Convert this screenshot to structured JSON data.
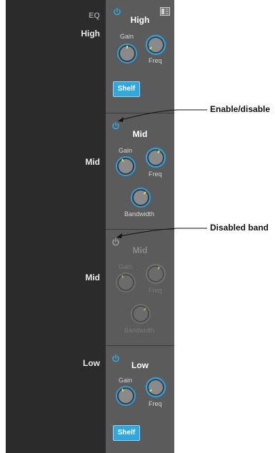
{
  "left_labels": {
    "eq": "EQ",
    "high": "High",
    "mid1": "Mid",
    "mid2": "Mid",
    "low": "Low"
  },
  "bands": [
    {
      "id": "high",
      "title": "High",
      "enabled": true,
      "knobs": {
        "gain": "Gain",
        "freq": "Freq"
      },
      "shelf": "Shelf"
    },
    {
      "id": "mid",
      "title": "Mid",
      "enabled": true,
      "knobs": {
        "gain": "Gain",
        "freq": "Freq",
        "bandwidth": "Bandwidth"
      }
    },
    {
      "id": "mid-disabled",
      "title": "Mid",
      "enabled": false,
      "knobs": {
        "gain": "Gain",
        "freq": "Freq",
        "bandwidth": "Bandwidth"
      }
    },
    {
      "id": "low",
      "title": "Low",
      "enabled": true,
      "knobs": {
        "gain": "Gain",
        "freq": "Freq"
      },
      "shelf": "Shelf"
    }
  ],
  "callouts": {
    "enable": "Enable/disable",
    "disabled": "Disabled band"
  },
  "colors": {
    "accent": "#2fa8e0",
    "knob_ring": "#2a9ee0",
    "indicator": "#d6e24c",
    "disabled": "#7a7a7a"
  }
}
